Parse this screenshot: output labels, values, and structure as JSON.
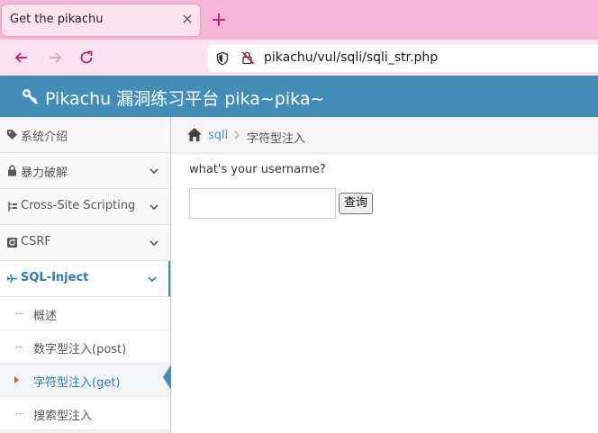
{
  "browser": {
    "tab_title": "Get the pikachu",
    "url": "pikachu/vul/sqli/sqli_str.php"
  },
  "header": {
    "brand": "Pikachu 漏洞练习平台 pika~pika~"
  },
  "sidebar": {
    "items": [
      {
        "label": "系统介绍",
        "icon": "tag-icon"
      },
      {
        "label": "暴力破解",
        "icon": "lock-icon"
      },
      {
        "label": "Cross-Site Scripting",
        "icon": "list-tree-icon"
      },
      {
        "label": "CSRF",
        "icon": "refresh-icon"
      },
      {
        "label": "SQL-Inject",
        "icon": "plane-icon"
      }
    ],
    "subitems": [
      {
        "label": "概述"
      },
      {
        "label": "数字型注入(post)"
      },
      {
        "label": "字符型注入(get)"
      },
      {
        "label": "搜索型注入"
      }
    ]
  },
  "breadcrumb": {
    "link": "sqli",
    "current": "字符型注入"
  },
  "main": {
    "question": "what's your username?",
    "input_value": "",
    "button_label": "查询"
  },
  "colors": {
    "header_bg": "#438eb9",
    "tab_strip": "#f6b6d8",
    "active_text": "#2b7dbc"
  }
}
